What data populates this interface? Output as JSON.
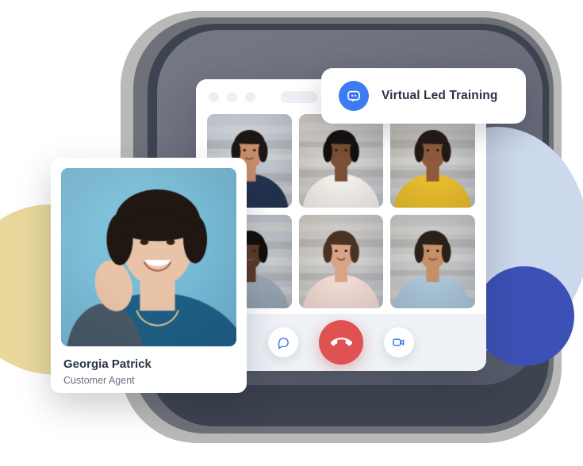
{
  "badge": {
    "label": "Virtual Led Training",
    "icon": "chat-bubble-icon",
    "icon_color": "#3C7BF0"
  },
  "app_window": {
    "titlebar": {
      "dots": [
        "window-dot-1",
        "window-dot-2",
        "window-dot-3"
      ],
      "placeholder_pill": ""
    },
    "video_grid": {
      "columns": 3,
      "rows": 2,
      "participants": [
        {
          "id": "participant-1",
          "label": "",
          "bg": "#cfd6de"
        },
        {
          "id": "participant-2",
          "label": "",
          "bg": "#d6cfc8"
        },
        {
          "id": "participant-3",
          "label": "",
          "bg": "#cfc9bf"
        },
        {
          "id": "participant-4",
          "label": "",
          "bg": "#c9cdd4"
        },
        {
          "id": "participant-5",
          "label": "",
          "bg": "#d3cec7"
        },
        {
          "id": "participant-6",
          "label": "",
          "bg": "#cdcbc6"
        }
      ]
    },
    "call_controls": [
      {
        "id": "chat-button",
        "icon": "chat-bubble-icon",
        "color": "#3C7BF0",
        "style": "light"
      },
      {
        "id": "end-call-button",
        "icon": "phone-hangup-icon",
        "color": "#E05252",
        "style": "danger"
      },
      {
        "id": "video-button",
        "icon": "video-camera-icon",
        "color": "#3C7BF0",
        "style": "light"
      }
    ]
  },
  "profile_card": {
    "name": "Georgia Patrick",
    "role": "Customer Agent",
    "photo_alt": "smiling woman with short dark hair on blue background"
  },
  "decor": {
    "blob_yellow": "#E9D89C",
    "blob_light_blue": "#CCD8EC",
    "blob_dark_blue": "#3C51B5",
    "plate_outer": "#B9B9B8",
    "plate_mid": "#6F7179",
    "plate_inner": "#3E4350"
  }
}
